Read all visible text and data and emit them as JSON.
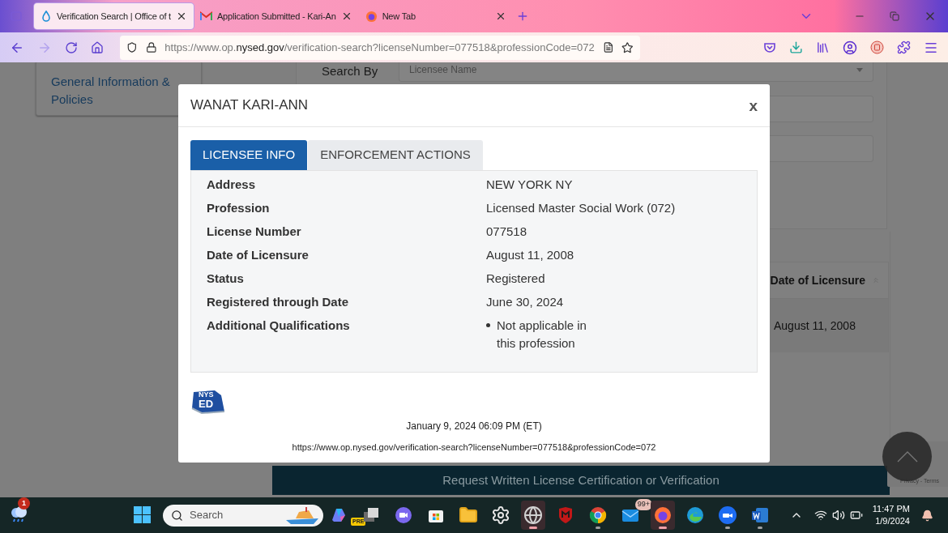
{
  "browser": {
    "tabs": [
      {
        "title": "Verification Search | Office of t",
        "selected": true,
        "kind": "drop"
      },
      {
        "title": "Application Submitted - Kari-An",
        "selected": false,
        "kind": "mail"
      },
      {
        "title": "New Tab",
        "selected": false,
        "kind": "fox"
      }
    ],
    "url": "https://www.op.**nysed.gov**/verification-search?licenseNumber=077518&professionCode=072"
  },
  "page": {
    "sidebar_link": "General Information & Policies",
    "search_by_label": "Search By",
    "search_by_value": "Licensee Name",
    "table_header": "Date of Licensure",
    "table_cell": "August 11, 2008",
    "request_button": "Request Written License Certification or Verification",
    "recaptcha_links": "Privacy - Terms"
  },
  "modal": {
    "title": "WANAT KARI-ANN",
    "close": "x",
    "tabs": [
      {
        "label": "LICENSEE INFO",
        "selected": true
      },
      {
        "label": "ENFORCEMENT ACTIONS",
        "selected": false
      }
    ],
    "fields": [
      {
        "label": "Address",
        "value": "NEW YORK NY"
      },
      {
        "label": "Profession",
        "value": "Licensed Master Social Work (072)"
      },
      {
        "label": "License Number",
        "value": "077518"
      },
      {
        "label": "Date of Licensure",
        "value": "August 11, 2008"
      },
      {
        "label": "Status",
        "value": "Registered"
      },
      {
        "label": "Registered through Date",
        "value": "June 30, 2024"
      },
      {
        "label": "Additional Qualifications",
        "bullets": [
          "Not applicable in this profession"
        ]
      }
    ],
    "logo_text": [
      "NYS",
      "ED"
    ],
    "timestamp": "January 9, 2024 06:09 PM (ET)",
    "url": "https://www.op.nysed.gov/verification-search?licenseNumber=077518&professionCode=072"
  },
  "taskbar": {
    "weather_badge": "1",
    "search_placeholder": "Search",
    "apps": [
      {
        "kind": "copilot",
        "badge": "PRE",
        "running": false,
        "active": false
      },
      {
        "kind": "taskview",
        "running": false,
        "active": false
      },
      {
        "kind": "teams",
        "running": false,
        "active": false
      },
      {
        "kind": "store",
        "running": false,
        "active": false
      },
      {
        "kind": "folder",
        "running": false,
        "active": false
      },
      {
        "kind": "settings",
        "running": false,
        "active": false
      },
      {
        "kind": "globe",
        "running": true,
        "active": true
      },
      {
        "kind": "shield",
        "running": false,
        "active": false
      },
      {
        "kind": "chrome",
        "running": true,
        "active": false
      },
      {
        "kind": "mail",
        "badge": "99+",
        "running": false,
        "active": false
      },
      {
        "kind": "fox",
        "running": true,
        "active": true
      },
      {
        "kind": "edge",
        "running": false,
        "active": false
      },
      {
        "kind": "zoom",
        "running": true,
        "active": false
      },
      {
        "kind": "word",
        "running": true,
        "active": false
      }
    ],
    "time": "11:47 PM",
    "date": "1/9/2024"
  }
}
